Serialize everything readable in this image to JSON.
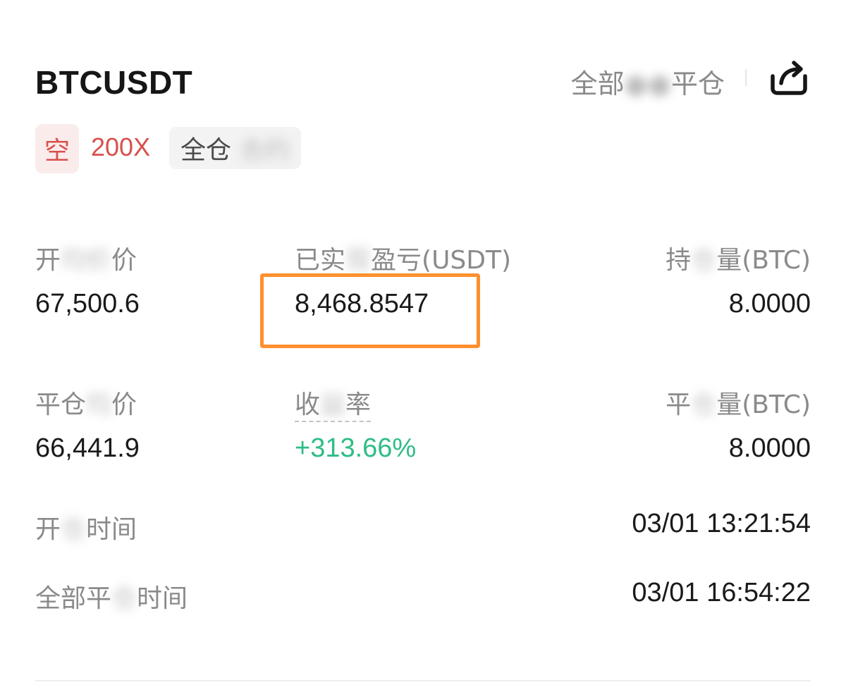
{
  "header": {
    "symbol": "BTCUSDT",
    "status_link_prefix": "全部",
    "status_link_suffix": "平仓",
    "share_icon": "share-icon"
  },
  "tags": {
    "side": "空",
    "leverage": "200X",
    "margin_mode_prefix": "全仓",
    "margin_mode_suffix": "合约"
  },
  "colors": {
    "short_red": "#d8504c",
    "profit_green": "#2ebd85",
    "highlight_orange": "#ff8f2e"
  },
  "fields": {
    "open_price": {
      "label_prefix": "开",
      "label_suffix": "价",
      "value": "67,500.6"
    },
    "realized_pnl": {
      "label_prefix": "已实",
      "label_suffix": "盈亏(USDT)",
      "value": "8,468.8547"
    },
    "position_size": {
      "label_prefix": "持",
      "label_suffix": "量(BTC)",
      "value": "8.0000"
    },
    "close_price": {
      "label_prefix": "平仓",
      "label_suffix": "价",
      "value": "66,441.9"
    },
    "roi": {
      "label_prefix": "收",
      "label_suffix": "率",
      "value": "+313.66%"
    },
    "close_size": {
      "label_prefix": "平",
      "label_suffix": "量(BTC)",
      "value": "8.0000"
    },
    "open_time": {
      "label_prefix": "开",
      "label_suffix": "时间",
      "value": "03/01 13:21:54"
    },
    "full_close_time": {
      "label_prefix": "全部平",
      "label_suffix": "时间",
      "value": "03/01 16:54:22"
    }
  }
}
